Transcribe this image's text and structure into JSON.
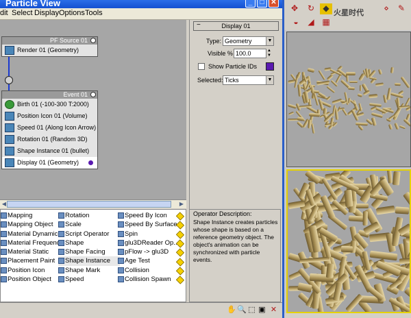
{
  "window": {
    "title": "Particle View",
    "menu": [
      "dit",
      "Select",
      "Display",
      "Options",
      "Tools"
    ]
  },
  "graph": {
    "source_node": {
      "title": "PF Source 01",
      "ops": [
        {
          "label": "Render 01 (Geometry)",
          "icon": "render-icon"
        }
      ]
    },
    "event_node": {
      "title": "Event 01",
      "ops": [
        {
          "label": "Birth 01 (-100-300 T:2000)",
          "icon": "birth-icon"
        },
        {
          "label": "Position Icon 01 (Volume)",
          "icon": "position-icon"
        },
        {
          "label": "Speed 01 (Along Icon Arrow)",
          "icon": "speed-icon"
        },
        {
          "label": "Rotation 01 (Random 3D)",
          "icon": "rotation-icon"
        },
        {
          "label": "Shape Instance 01 (bullet)",
          "icon": "shape-instance-icon"
        },
        {
          "label": "Display 01 (Geometry)",
          "icon": "display-icon"
        }
      ]
    }
  },
  "params": {
    "rollout_title": "Display 01",
    "type_label": "Type:",
    "type_value": "Geometry",
    "visible_label": "Visible %",
    "visible_value": "100.0",
    "show_ids_label": "Show Particle IDs",
    "selected_label": "Selected:",
    "selected_value": "Ticks",
    "display_color": "#5a1ab0"
  },
  "depot": {
    "col1": [
      "Mapping",
      "Mapping Object",
      "Material Dynamic",
      "Material Frequency",
      "Material Static",
      "Placement Paint",
      "Position Icon",
      "Position Object"
    ],
    "col2": [
      "Rotation",
      "Scale",
      "Script Operator",
      "Shape",
      "Shape Facing",
      "Shape Instance",
      "Shape Mark",
      "Speed"
    ],
    "col3": [
      "Speed By Icon",
      "Speed By Surface",
      "Spin",
      "glu3DReader Op...",
      "pFlow -> glu3D",
      "Age Test",
      "Collision",
      "Collision Spawn"
    ],
    "highlighted": "Shape Instance"
  },
  "description": {
    "heading": "Operator Description:",
    "text": "Shape Instance creates particles whose shape is based on a reference geometry object. The object's animation can be synchronized with particle events."
  },
  "logo_text": "火星时代",
  "icons": {
    "pan": "hand-icon",
    "zoom": "magnifier-icon",
    "zoom_region": "zoom-region-icon",
    "zoom_extents": "zoom-extents-icon",
    "no_draw": "no-draw-icon"
  }
}
